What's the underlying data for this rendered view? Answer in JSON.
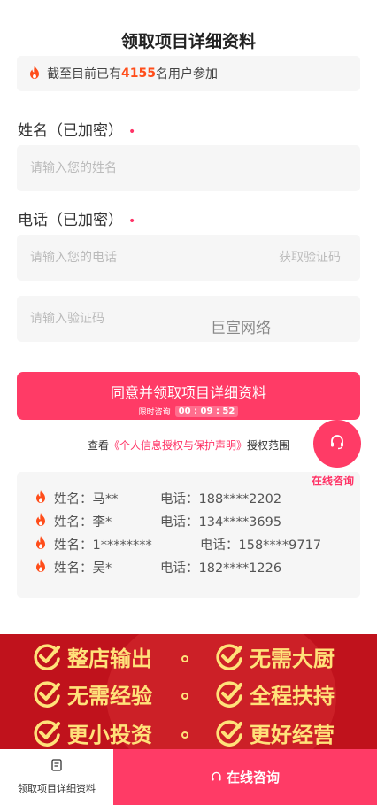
{
  "page": {
    "title": "领取项目详细资料"
  },
  "notice": {
    "prefix": "截至目前已有",
    "count": "4155",
    "suffix": "名用户参加",
    "icon": "fire-icon"
  },
  "form": {
    "name_label": "姓名（已加密）",
    "name_placeholder": "请输入您的姓名",
    "phone_label": "电话（已加密）",
    "phone_placeholder": "请输入您的电话",
    "get_code_label": "获取验证码",
    "code_placeholder": "请输入验证码",
    "required_dot": "•"
  },
  "watermark": "巨宣网络",
  "submit": {
    "label": "同意并领取项目详细资料",
    "limited_text": "限时咨询",
    "timer": "00 : 09 : 52"
  },
  "agreement": {
    "prefix": "查看",
    "link": "《个人信息授权与保护声明》",
    "suffix": "授权范围"
  },
  "consult": {
    "label": "在线咨询",
    "icon": "headset-icon"
  },
  "records": [
    {
      "name": "姓名：马**",
      "phone": "电话：188****2202"
    },
    {
      "name": "姓名：李*",
      "phone": "电话：134****3695"
    },
    {
      "name": "姓名：1********",
      "phone": "电话：158****9717"
    },
    {
      "name": "姓名：吴*",
      "phone": "电话：182****1226"
    }
  ],
  "banner": {
    "items": [
      "整店输出",
      "无需大厨",
      "无需经验",
      "全程扶持",
      "更小投资",
      "更好经营"
    ]
  },
  "bottom_bar": {
    "left_label": "领取项目详细资料",
    "right_label": "在线咨询"
  },
  "colors": {
    "accent": "#ff3b66",
    "fire": "#ff4d1a",
    "banner": "#c0121c",
    "banner_text": "#ffe27a"
  }
}
